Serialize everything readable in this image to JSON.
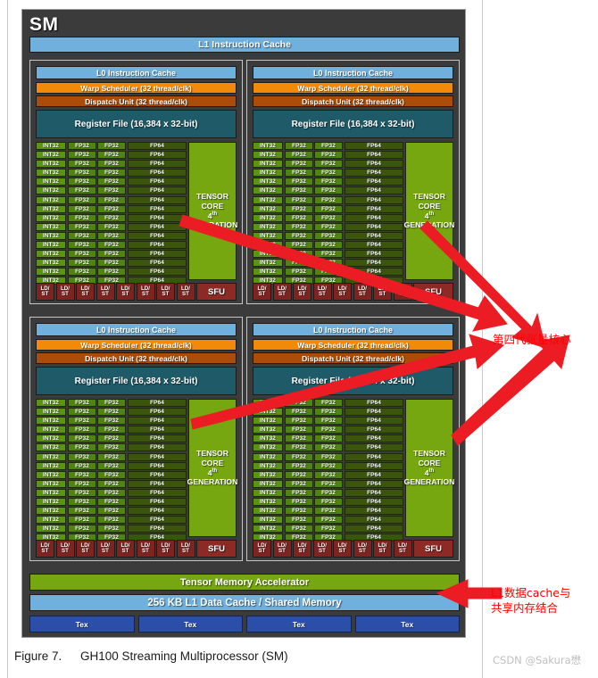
{
  "page": {
    "figure_label": "Figure 7.",
    "figure_title": "GH100 Streaming Multiprocessor (SM)",
    "watermark": "CSDN @Sakura懋"
  },
  "sm": {
    "title": "SM",
    "l1_instruction_cache": "L1 Instruction Cache",
    "tensor_memory_accelerator": "Tensor Memory Accelerator",
    "l1_data_cache": "256 KB L1 Data Cache / Shared Memory",
    "tex_label": "Tex",
    "tex_count": 4,
    "partition": {
      "l0_instruction_cache": "L0 Instruction Cache",
      "warp_scheduler": "Warp Scheduler (32 thread/clk)",
      "dispatch_unit": "Dispatch Unit (32 thread/clk)",
      "register_file": "Register File (16,384 x 32-bit)",
      "int32_label": "INT32",
      "fp32_label": "FP32",
      "fp64_label": "FP64",
      "lane_rows": 16,
      "tensor_core_line1": "TENSOR CORE",
      "tensor_core_line2_prefix": "4",
      "tensor_core_line2_sup": "th",
      "tensor_core_line2_suffix": " GENERATION",
      "ldst_line1": "LD/",
      "ldst_line2": "ST",
      "ldst_count": 8,
      "sfu_label": "SFU"
    },
    "partition_count": 4
  },
  "annotations": {
    "tensor_core_note": "第四代张量核心",
    "cache_note_line1": "L1数据cache与",
    "cache_note_line2": "共享内存结合"
  },
  "colors": {
    "chassis": "#3b3b3b",
    "instruction_cache": "#6fb0de",
    "warp_scheduler": "#f08a08",
    "dispatch_unit": "#ad4c06",
    "register_file": "#1e5a68",
    "int32": "#5b9412",
    "fp32": "#4f8410",
    "fp64": "#3b560c",
    "tensor_core": "#76a610",
    "ldst": "#7d2420",
    "sfu": "#8e2a25",
    "tex": "#2b4fa8",
    "annotation": "#ff0000"
  }
}
